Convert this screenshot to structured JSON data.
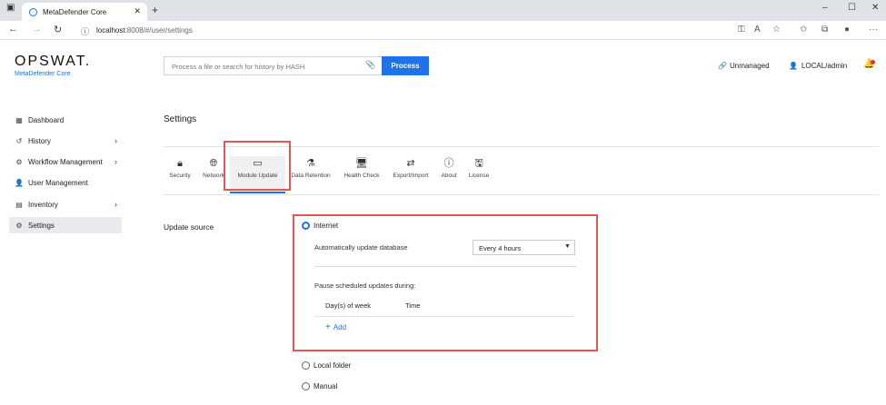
{
  "browser": {
    "tab_title": "MetaDefender Core",
    "url_host": "localhost",
    "url_path": ":8008/#/user/settings"
  },
  "header": {
    "logo": "OPSWAT.",
    "logo_sub": "MetaDefender Core",
    "search_placeholder": "Process a file or search for history by HASH",
    "process_label": "Process",
    "unmanaged_label": "Unmanaged",
    "user_label": "LOCAL/admin"
  },
  "sidebar": {
    "items": [
      {
        "label": "Dashboard",
        "icon": "dashboard-icon"
      },
      {
        "label": "History",
        "icon": "history-icon"
      },
      {
        "label": "Workflow Management",
        "icon": "workflow-icon"
      },
      {
        "label": "User Management",
        "icon": "user-icon"
      },
      {
        "label": "Inventory",
        "icon": "inventory-icon"
      },
      {
        "label": "Settings",
        "icon": "gear-icon"
      }
    ]
  },
  "settings": {
    "title": "Settings",
    "tabs": [
      {
        "label": "Security",
        "icon": "lock-icon"
      },
      {
        "label": "Network",
        "icon": "globe-icon"
      },
      {
        "label": "Module Update",
        "icon": "module-icon"
      },
      {
        "label": "Data Retention",
        "icon": "flask-icon"
      },
      {
        "label": "Health Check",
        "icon": "monitor-icon"
      },
      {
        "label": "Export/Import",
        "icon": "arrows-icon"
      },
      {
        "label": "About",
        "icon": "info-icon"
      },
      {
        "label": "License",
        "icon": "license-icon"
      }
    ],
    "active_tab": "Module Update"
  },
  "update_source": {
    "label": "Update source",
    "options": [
      "Internet",
      "Local folder",
      "Manual"
    ],
    "selected": "Internet",
    "auto_update_label": "Automatically update database",
    "auto_update_value": "Every 4 hours",
    "pause_label": "Pause scheduled updates during:",
    "columns": [
      "Day(s) of week",
      "Time"
    ],
    "add_label": "Add"
  },
  "colors": {
    "accent": "#1e73e8",
    "highlight_box": "#e0584f"
  }
}
